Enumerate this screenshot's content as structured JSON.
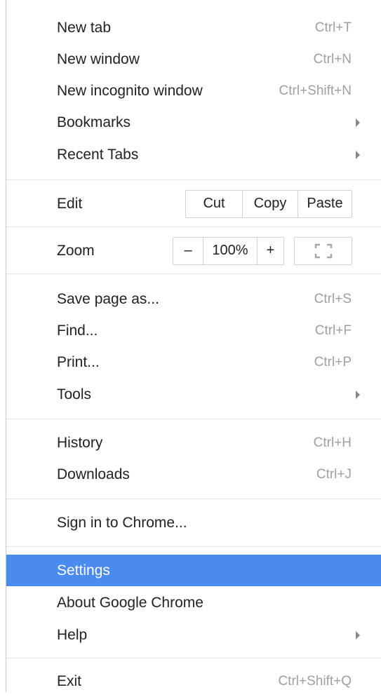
{
  "menu": {
    "new_tab": {
      "label": "New tab",
      "shortcut": "Ctrl+T"
    },
    "new_window": {
      "label": "New window",
      "shortcut": "Ctrl+N"
    },
    "new_incognito": {
      "label": "New incognito window",
      "shortcut": "Ctrl+Shift+N"
    },
    "bookmarks": {
      "label": "Bookmarks",
      "icon": "submenu-arrow-icon"
    },
    "recent_tabs": {
      "label": "Recent Tabs",
      "icon": "submenu-arrow-icon"
    },
    "edit": {
      "label": "Edit",
      "cut": "Cut",
      "copy": "Copy",
      "paste": "Paste"
    },
    "zoom": {
      "label": "Zoom",
      "minus": "–",
      "value": "100%",
      "plus": "+",
      "fullscreen_icon": "fullscreen-icon"
    },
    "save_page": {
      "label": "Save page as...",
      "shortcut": "Ctrl+S"
    },
    "find": {
      "label": "Find...",
      "shortcut": "Ctrl+F"
    },
    "print": {
      "label": "Print...",
      "shortcut": "Ctrl+P"
    },
    "tools": {
      "label": "Tools",
      "icon": "submenu-arrow-icon"
    },
    "history": {
      "label": "History",
      "shortcut": "Ctrl+H"
    },
    "downloads": {
      "label": "Downloads",
      "shortcut": "Ctrl+J"
    },
    "sign_in": {
      "label": "Sign in to Chrome..."
    },
    "settings": {
      "label": "Settings",
      "highlighted": true
    },
    "about": {
      "label": "About Google Chrome"
    },
    "help": {
      "label": "Help",
      "icon": "submenu-arrow-icon"
    },
    "exit": {
      "label": "Exit",
      "shortcut": "Ctrl+Shift+Q"
    }
  },
  "colors": {
    "highlight": "#4a8bf0",
    "shortcut_text": "#a0a0a0",
    "separator": "#e3e3e3"
  }
}
